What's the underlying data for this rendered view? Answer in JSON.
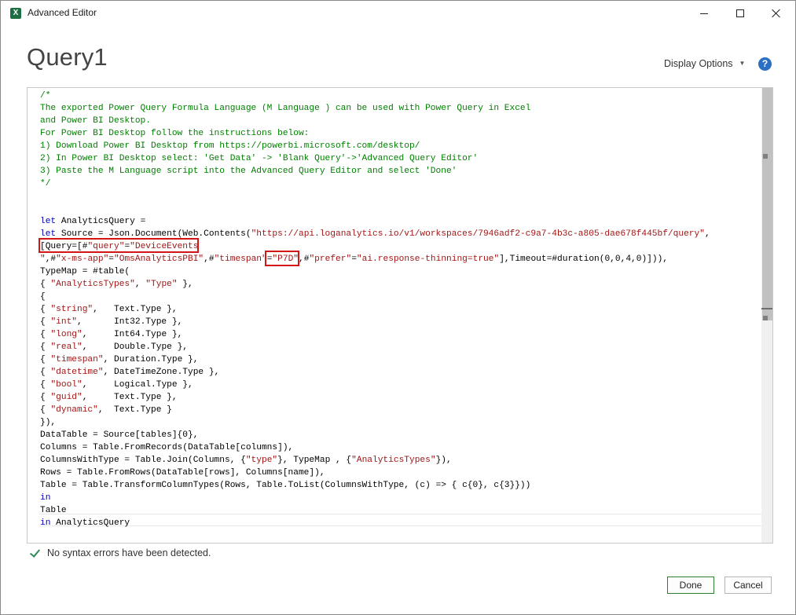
{
  "window": {
    "title": "Advanced Editor",
    "app_icon_letter": "X"
  },
  "header": {
    "query_name": "Query1",
    "display_options_label": "Display Options",
    "help_label": "?"
  },
  "editor": {
    "lines": [
      {
        "segments": [
          {
            "t": "/*",
            "c": "cm"
          }
        ]
      },
      {
        "segments": [
          {
            "t": "The exported Power Query Formula Language (M Language ) can be used with Power Query in Excel",
            "c": "cm"
          }
        ]
      },
      {
        "segments": [
          {
            "t": "and Power BI Desktop.",
            "c": "cm"
          }
        ]
      },
      {
        "segments": [
          {
            "t": "For Power BI Desktop follow the instructions below:",
            "c": "cm"
          }
        ]
      },
      {
        "segments": [
          {
            "t": "1) Download Power BI Desktop from https://powerbi.microsoft.com/desktop/",
            "c": "cm"
          }
        ]
      },
      {
        "segments": [
          {
            "t": "2) In Power BI Desktop select: 'Get Data' -> 'Blank Query'->'Advanced Query Editor'",
            "c": "cm"
          }
        ]
      },
      {
        "segments": [
          {
            "t": "3) Paste the M Language script into the Advanced Query Editor and select 'Done'",
            "c": "cm"
          }
        ]
      },
      {
        "segments": [
          {
            "t": "*/",
            "c": "cm"
          }
        ]
      },
      {
        "segments": []
      },
      {
        "segments": []
      },
      {
        "segments": [
          {
            "t": "let",
            "c": "kw"
          },
          {
            "t": " AnalyticsQuery =",
            "c": ""
          }
        ]
      },
      {
        "segments": [
          {
            "t": "let",
            "c": "kw"
          },
          {
            "t": " Source = Json.Document(Web.Contents(",
            "c": ""
          },
          {
            "t": "\"https://api.loganalytics.io/v1/workspaces/7946adf2-c9a7-4b3c-a805-dae678f445bf/query\"",
            "c": "st"
          },
          {
            "t": ",",
            "c": ""
          }
        ]
      },
      {
        "segments": [
          {
            "t": "[Query=[#",
            "c": ""
          },
          {
            "t": "\"query\"",
            "c": "st"
          },
          {
            "t": "=",
            "c": ""
          },
          {
            "t": "\"DeviceEvents",
            "c": "st"
          }
        ]
      },
      {
        "segments": [
          {
            "t": "\"",
            "c": "st"
          },
          {
            "t": ",#",
            "c": ""
          },
          {
            "t": "\"x-ms-app\"",
            "c": "st"
          },
          {
            "t": "=",
            "c": ""
          },
          {
            "t": "\"OmsAnalyticsPBI\"",
            "c": "st"
          },
          {
            "t": ",#",
            "c": ""
          },
          {
            "t": "\"timespan\"",
            "c": "st"
          },
          {
            "t": "=",
            "c": ""
          },
          {
            "t": "\"P7D\"",
            "c": "st"
          },
          {
            "t": ",#",
            "c": ""
          },
          {
            "t": "\"prefer\"",
            "c": "st"
          },
          {
            "t": "=",
            "c": ""
          },
          {
            "t": "\"ai.response-thinning=true\"",
            "c": "st"
          },
          {
            "t": "],Timeout=#duration(0,0,4,0)])),",
            "c": ""
          }
        ]
      },
      {
        "segments": [
          {
            "t": "TypeMap = #table(",
            "c": ""
          }
        ]
      },
      {
        "segments": [
          {
            "t": "{ ",
            "c": ""
          },
          {
            "t": "\"AnalyticsTypes\"",
            "c": "st"
          },
          {
            "t": ", ",
            "c": ""
          },
          {
            "t": "\"Type\"",
            "c": "st"
          },
          {
            "t": " },",
            "c": ""
          }
        ]
      },
      {
        "segments": [
          {
            "t": "{",
            "c": ""
          }
        ]
      },
      {
        "segments": [
          {
            "t": "{ ",
            "c": ""
          },
          {
            "t": "\"string\"",
            "c": "st"
          },
          {
            "t": ",   Text.Type },",
            "c": ""
          }
        ]
      },
      {
        "segments": [
          {
            "t": "{ ",
            "c": ""
          },
          {
            "t": "\"int\"",
            "c": "st"
          },
          {
            "t": ",      Int32.Type },",
            "c": ""
          }
        ]
      },
      {
        "segments": [
          {
            "t": "{ ",
            "c": ""
          },
          {
            "t": "\"long\"",
            "c": "st"
          },
          {
            "t": ",     Int64.Type },",
            "c": ""
          }
        ]
      },
      {
        "segments": [
          {
            "t": "{ ",
            "c": ""
          },
          {
            "t": "\"real\"",
            "c": "st"
          },
          {
            "t": ",     Double.Type },",
            "c": ""
          }
        ]
      },
      {
        "segments": [
          {
            "t": "{ ",
            "c": ""
          },
          {
            "t": "\"timespan\"",
            "c": "st"
          },
          {
            "t": ", Duration.Type },",
            "c": ""
          }
        ]
      },
      {
        "segments": [
          {
            "t": "{ ",
            "c": ""
          },
          {
            "t": "\"datetime\"",
            "c": "st"
          },
          {
            "t": ", DateTimeZone.Type },",
            "c": ""
          }
        ]
      },
      {
        "segments": [
          {
            "t": "{ ",
            "c": ""
          },
          {
            "t": "\"bool\"",
            "c": "st"
          },
          {
            "t": ",     Logical.Type },",
            "c": ""
          }
        ]
      },
      {
        "segments": [
          {
            "t": "{ ",
            "c": ""
          },
          {
            "t": "\"guid\"",
            "c": "st"
          },
          {
            "t": ",     Text.Type },",
            "c": ""
          }
        ]
      },
      {
        "segments": [
          {
            "t": "{ ",
            "c": ""
          },
          {
            "t": "\"dynamic\"",
            "c": "st"
          },
          {
            "t": ",  Text.Type }",
            "c": ""
          }
        ]
      },
      {
        "segments": [
          {
            "t": "}),",
            "c": ""
          }
        ]
      },
      {
        "segments": [
          {
            "t": "DataTable = Source[tables]{0},",
            "c": ""
          }
        ]
      },
      {
        "segments": [
          {
            "t": "Columns = Table.FromRecords(DataTable[columns]),",
            "c": ""
          }
        ]
      },
      {
        "segments": [
          {
            "t": "ColumnsWithType = Table.Join(Columns, {",
            "c": ""
          },
          {
            "t": "\"type\"",
            "c": "st"
          },
          {
            "t": "}, TypeMap , {",
            "c": ""
          },
          {
            "t": "\"AnalyticsTypes\"",
            "c": "st"
          },
          {
            "t": "}),",
            "c": ""
          }
        ]
      },
      {
        "segments": [
          {
            "t": "Rows = Table.FromRows(DataTable[rows], Columns[name]),",
            "c": ""
          }
        ]
      },
      {
        "segments": [
          {
            "t": "Table = Table.TransformColumnTypes(Rows, Table.ToList(ColumnsWithType, (c) => { c{0}, c{3}}))",
            "c": ""
          }
        ]
      },
      {
        "segments": [
          {
            "t": "in",
            "c": "kw"
          }
        ]
      },
      {
        "segments": [
          {
            "t": "Table",
            "c": ""
          }
        ]
      },
      {
        "segments": [
          {
            "t": "in",
            "c": "kw"
          },
          {
            "t": " AnalyticsQuery",
            "c": ""
          }
        ]
      }
    ]
  },
  "status": {
    "message": "No syntax errors have been detected."
  },
  "buttons": {
    "done_label": "Done",
    "cancel_label": "Cancel"
  },
  "colors": {
    "comment": "#008000",
    "keyword": "#0000c0",
    "string": "#a31515",
    "highlight_box": "#d31515"
  }
}
